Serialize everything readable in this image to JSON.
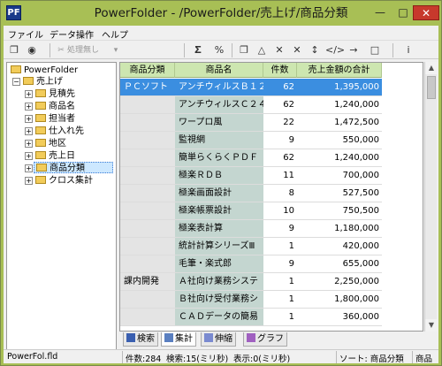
{
  "window": {
    "title": "PowerFolder - /PowerFolder/売上げ/商品分類",
    "icon_label": "PF"
  },
  "menu": [
    "ファイル",
    "データ操作",
    "ヘルプ"
  ],
  "toolbar": {
    "no_process_label": "処理無し",
    "buttons": [
      "x",
      "%",
      "x",
      "=",
      "sum",
      "order",
      "html",
      "copy",
      "info"
    ]
  },
  "tree": {
    "root": "PowerFolder",
    "folder": "売上げ",
    "items": [
      "見積先",
      "商品名",
      "担当者",
      "仕入れ先",
      "地区",
      "売上日",
      "商品分類",
      "クロス集計"
    ],
    "selected": "商品分類"
  },
  "grid": {
    "columns": [
      "商品分類",
      "商品名",
      "件数",
      "売上金額の合計"
    ],
    "rows": [
      {
        "category": "ＰＣソフト",
        "name": "アンチウィルスＢ１２",
        "count": "62",
        "amount": "1,395,000",
        "selected": true
      },
      {
        "category": "",
        "name": "アンチウィルスＣ２４",
        "count": "62",
        "amount": "1,240,000"
      },
      {
        "category": "",
        "name": "ワープロ風",
        "count": "22",
        "amount": "1,472,500"
      },
      {
        "category": "",
        "name": "監視網",
        "count": "9",
        "amount": "550,000"
      },
      {
        "category": "",
        "name": "簡単らくらくＰＤＦ",
        "count": "62",
        "amount": "1,240,000"
      },
      {
        "category": "",
        "name": "極楽ＲＤＢ",
        "count": "11",
        "amount": "700,000"
      },
      {
        "category": "",
        "name": "極楽画面設計",
        "count": "8",
        "amount": "527,500"
      },
      {
        "category": "",
        "name": "極楽帳票設計",
        "count": "10",
        "amount": "750,500"
      },
      {
        "category": "",
        "name": "極楽表計算",
        "count": "9",
        "amount": "1,180,000"
      },
      {
        "category": "",
        "name": "統計計算シリーズⅢ",
        "count": "1",
        "amount": "420,000"
      },
      {
        "category": "",
        "name": "毛筆・楽式郎",
        "count": "9",
        "amount": "655,000"
      },
      {
        "category": "課内開発",
        "name": "Ａ社向け業務システ",
        "count": "1",
        "amount": "2,250,000"
      },
      {
        "category": "",
        "name": "Ｂ社向け受付業務シ",
        "count": "1",
        "amount": "1,800,000"
      },
      {
        "category": "",
        "name": "ＣＡＤデータの簡易",
        "count": "1",
        "amount": "360,000"
      }
    ]
  },
  "tabs": [
    "検索",
    "集計",
    "伸縮",
    "グラフ"
  ],
  "active_tab": "集計",
  "status": {
    "file": "PowerFol.fld",
    "count": "件数:284",
    "search": "検索:15(ミリ秒)",
    "display": "表示:0(ミリ秒)",
    "sort": "ソート: 商品分類",
    "sort_overflow": "商品"
  }
}
